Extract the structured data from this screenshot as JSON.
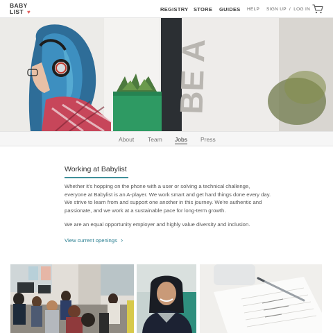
{
  "logo": {
    "line1": "BABY",
    "line2": "LIST",
    "heart": "♥"
  },
  "nav": {
    "registry": "REGISTRY",
    "store": "STORE",
    "guides": "GUIDES",
    "help": "HELP",
    "auth": "SIGN UP  /  LOG IN",
    "cart_icon": "cart-icon"
  },
  "tabs": [
    {
      "label": "About",
      "active": false
    },
    {
      "label": "Team",
      "active": false
    },
    {
      "label": "Jobs",
      "active": true
    },
    {
      "label": "Press",
      "active": false
    }
  ],
  "section": {
    "title": "Working at Babylist",
    "paragraph1": "Whether it's hopping on the phone with a user or solving a technical challenge, everyone at Babylist is an A-player. We work smart and get hard things done every day. We strive to learn from and support one another in this journey. We're authentic and passionate, and we work at a sustainable pace for long-term growth.",
    "paragraph2": "We are an equal opportunity employer and highly value diversity and inclusion.",
    "link_label": "View current openings",
    "link_chevron": "›"
  },
  "colors": {
    "accent": "#3e8f9a",
    "link": "#2a7f91",
    "heart": "#e05b5b"
  }
}
